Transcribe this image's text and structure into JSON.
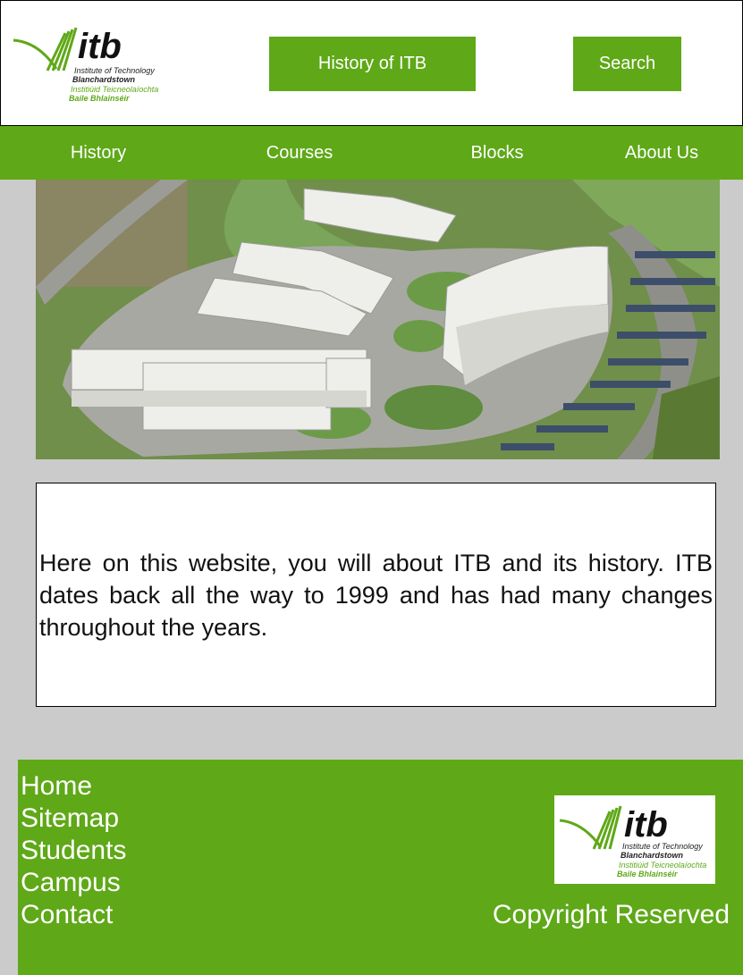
{
  "header": {
    "logo": {
      "wordmark": "itb",
      "line1": "Institute of Technology",
      "line2": "Blanchardstown",
      "line3": "Institiúid Teicneolaíochta",
      "line4": "Baile Bhlainséir"
    },
    "history_button": "History of ITB",
    "search_button": "Search"
  },
  "nav": {
    "items": [
      {
        "label": "History"
      },
      {
        "label": "Courses"
      },
      {
        "label": "Blocks"
      },
      {
        "label": "About Us"
      }
    ]
  },
  "intro": {
    "text": "Here on this website, you will about ITB and its history. ITB dates back all the way to 1999 and has had many changes throughout the years."
  },
  "footer": {
    "links": [
      "Home",
      "Sitemap",
      "Students",
      "Campus",
      "Contact"
    ],
    "copyright": "Copyright Reserved"
  },
  "colors": {
    "brand_green": "#5fa818",
    "page_background": "#cbcbcb"
  }
}
